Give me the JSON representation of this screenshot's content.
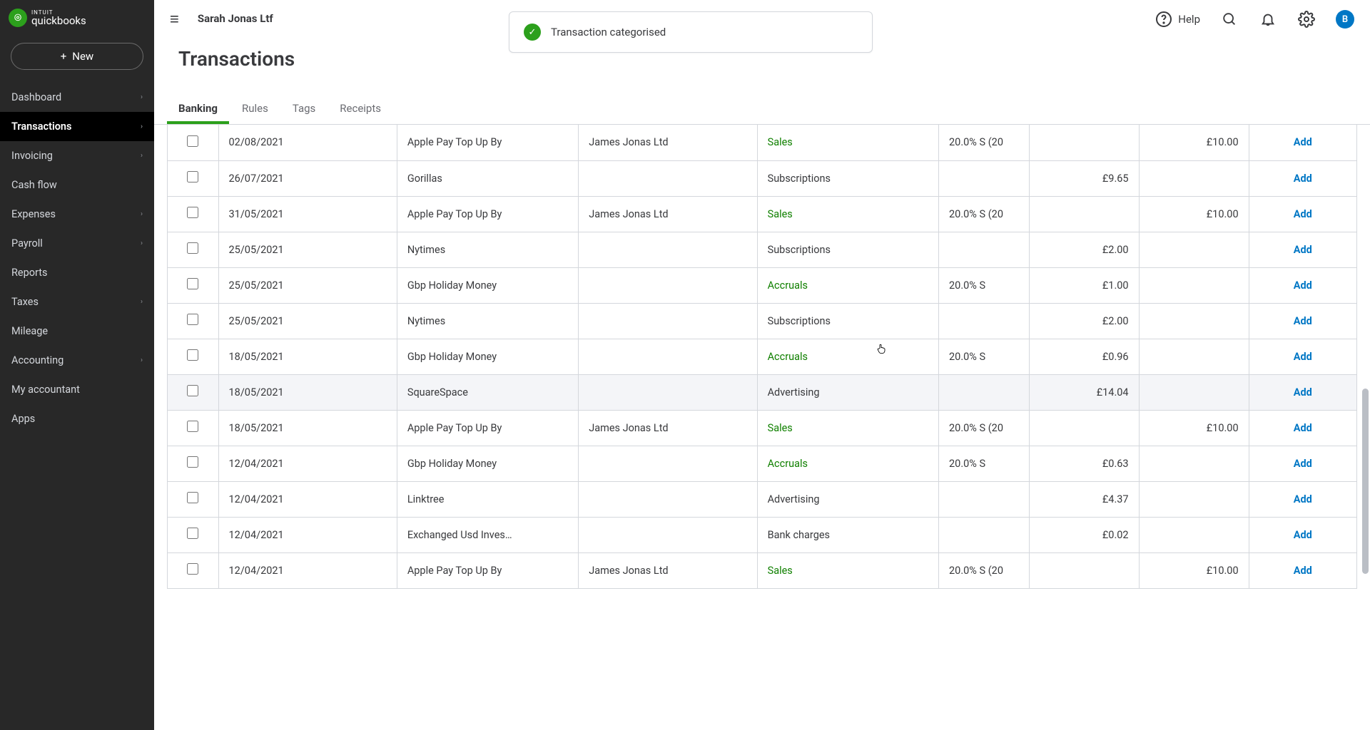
{
  "header": {
    "logo_intuit": "INTUIT",
    "logo_qb": "quickbooks",
    "company": "Sarah Jonas Ltf",
    "help": "Help",
    "avatar_initial": "B"
  },
  "toast": {
    "message": "Transaction categorised"
  },
  "sidebar": {
    "new_label": "New",
    "items": [
      {
        "label": "Dashboard",
        "chev": true
      },
      {
        "label": "Transactions",
        "chev": true,
        "active": true
      },
      {
        "label": "Invoicing",
        "chev": true
      },
      {
        "label": "Cash flow",
        "chev": false
      },
      {
        "label": "Expenses",
        "chev": true
      },
      {
        "label": "Payroll",
        "chev": true
      },
      {
        "label": "Reports",
        "chev": false
      },
      {
        "label": "Taxes",
        "chev": true
      },
      {
        "label": "Mileage",
        "chev": false
      },
      {
        "label": "Accounting",
        "chev": true
      },
      {
        "label": "My accountant",
        "chev": false
      },
      {
        "label": "Apps",
        "chev": false
      }
    ]
  },
  "page": {
    "title": "Transactions"
  },
  "tabs": [
    {
      "label": "Banking",
      "active": true
    },
    {
      "label": "Rules"
    },
    {
      "label": "Tags"
    },
    {
      "label": "Receipts"
    }
  ],
  "table": {
    "add_label": "Add",
    "rows": [
      {
        "date": "02/08/2021",
        "desc": "Apple Pay Top Up By",
        "payee": "James Jonas Ltd",
        "cat": "Sales",
        "cat_green": true,
        "vat": "20.0% S (20",
        "spent": "",
        "received": "£10.00"
      },
      {
        "date": "26/07/2021",
        "desc": "Gorillas",
        "payee": "",
        "cat": "Subscriptions",
        "vat": "",
        "spent": "£9.65",
        "received": ""
      },
      {
        "date": "31/05/2021",
        "desc": "Apple Pay Top Up By",
        "payee": "James Jonas Ltd",
        "cat": "Sales",
        "cat_green": true,
        "vat": "20.0% S (20",
        "spent": "",
        "received": "£10.00"
      },
      {
        "date": "25/05/2021",
        "desc": "Nytimes",
        "payee": "",
        "cat": "Subscriptions",
        "vat": "",
        "spent": "£2.00",
        "received": ""
      },
      {
        "date": "25/05/2021",
        "desc": "Gbp Holiday Money",
        "payee": "",
        "cat": "Accruals",
        "cat_green": true,
        "vat": "20.0% S",
        "spent": "£1.00",
        "received": ""
      },
      {
        "date": "25/05/2021",
        "desc": "Nytimes",
        "payee": "",
        "cat": "Subscriptions",
        "vat": "",
        "spent": "£2.00",
        "received": ""
      },
      {
        "date": "18/05/2021",
        "desc": "Gbp Holiday Money",
        "payee": "",
        "cat": "Accruals",
        "cat_green": true,
        "vat": "20.0% S",
        "spent": "£0.96",
        "received": ""
      },
      {
        "date": "18/05/2021",
        "desc": "SquareSpace",
        "payee": "",
        "cat": "Advertising",
        "vat": "",
        "spent": "£14.04",
        "received": "",
        "hover": true
      },
      {
        "date": "18/05/2021",
        "desc": "Apple Pay Top Up By",
        "payee": "James Jonas Ltd",
        "cat": "Sales",
        "cat_green": true,
        "vat": "20.0% S (20",
        "spent": "",
        "received": "£10.00"
      },
      {
        "date": "12/04/2021",
        "desc": "Gbp Holiday Money",
        "payee": "",
        "cat": "Accruals",
        "cat_green": true,
        "vat": "20.0% S",
        "spent": "£0.63",
        "received": ""
      },
      {
        "date": "12/04/2021",
        "desc": "Linktree",
        "payee": "",
        "cat": "Advertising",
        "vat": "",
        "spent": "£4.37",
        "received": ""
      },
      {
        "date": "12/04/2021",
        "desc": "Exchanged Usd Inves…",
        "payee": "",
        "cat": "Bank charges",
        "vat": "",
        "spent": "£0.02",
        "received": ""
      },
      {
        "date": "12/04/2021",
        "desc": "Apple Pay Top Up By",
        "payee": "James Jonas Ltd",
        "cat": "Sales",
        "cat_green": true,
        "vat": "20.0% S (20",
        "spent": "",
        "received": "£10.00"
      }
    ]
  }
}
